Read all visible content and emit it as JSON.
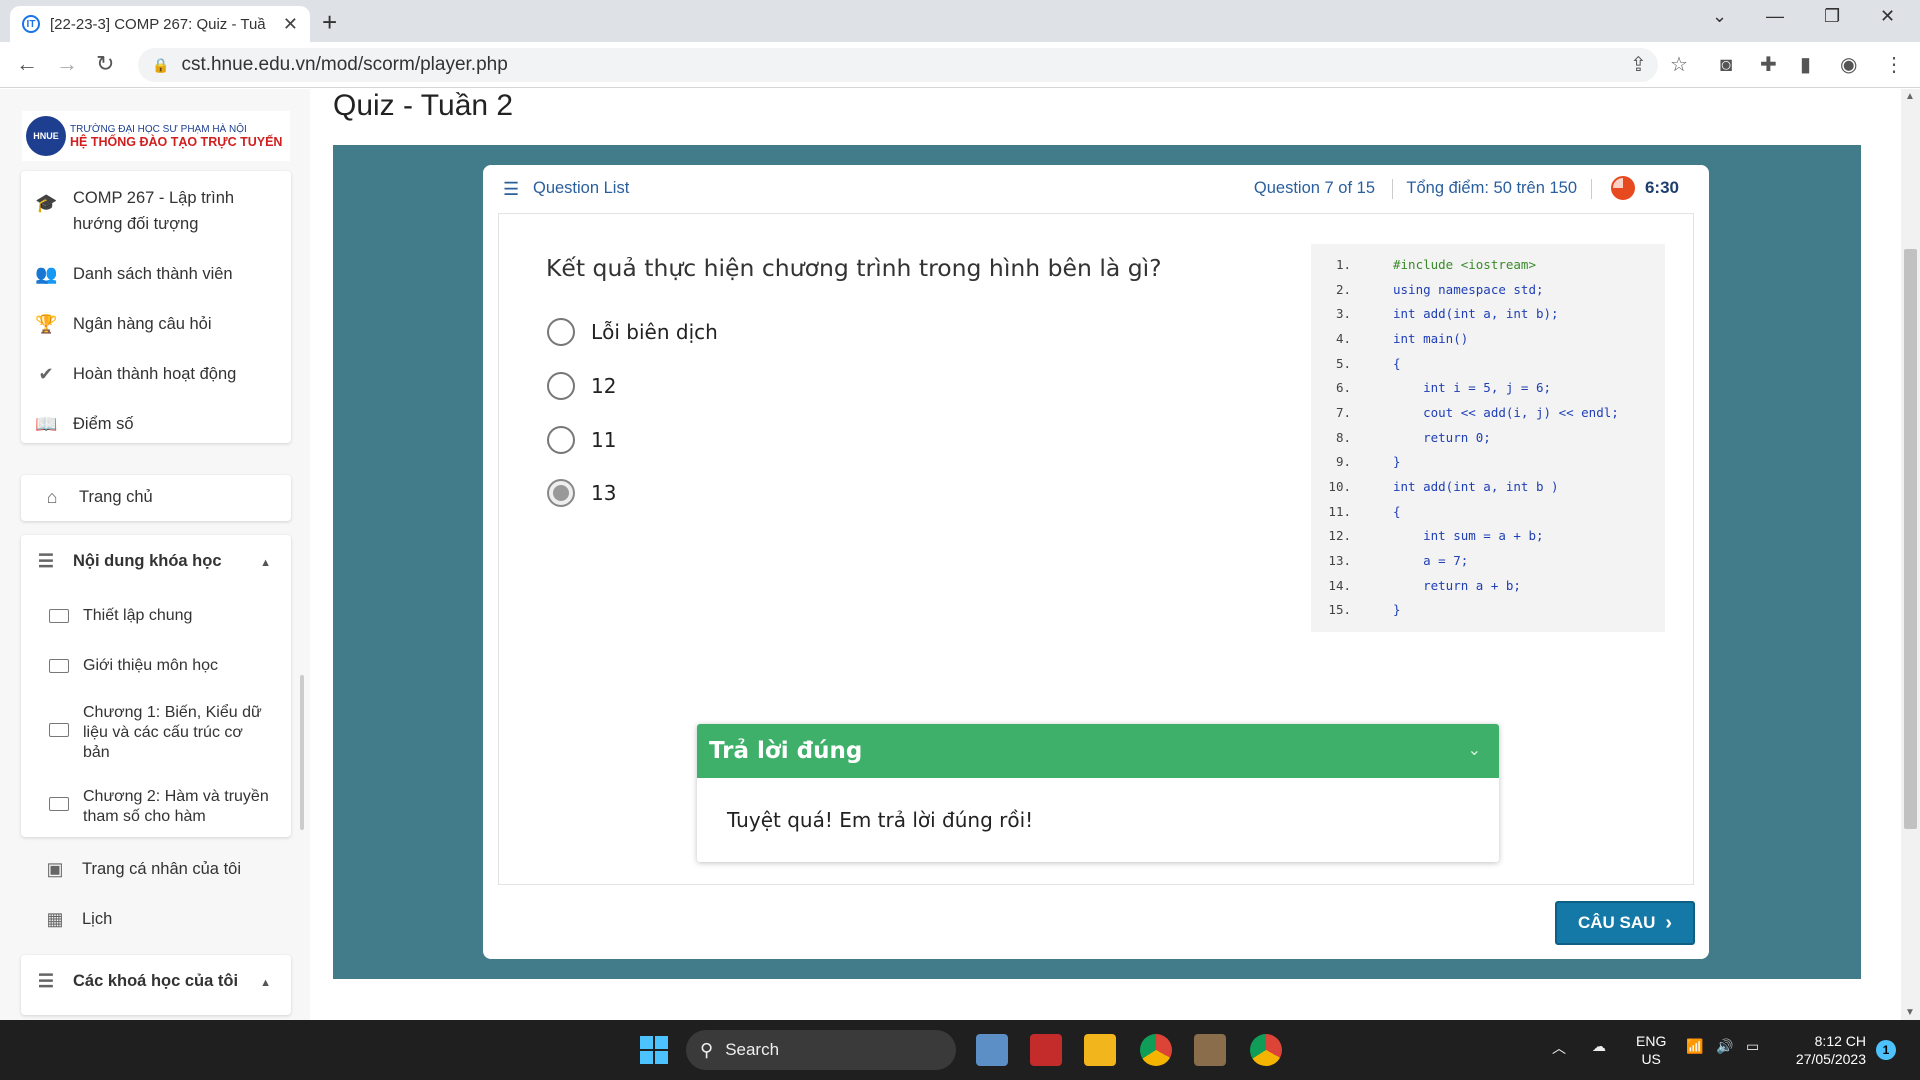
{
  "browser": {
    "tab_title": "[22-23-3] COMP 267: Quiz - Tuầ",
    "url": "cst.hnue.edu.vn/mod/scorm/player.php"
  },
  "sidebar": {
    "logo_line1": "TRƯỜNG ĐẠI HỌC SƯ PHẠM HÀ NỘI",
    "logo_line2": "HỆ THỐNG ĐÀO TẠO TRỰC TUYẾN",
    "course_menu": [
      {
        "label": "COMP 267 - Lập trình hướng đối tượng",
        "icon": "graduation-cap-icon"
      },
      {
        "label": "Danh sách thành viên",
        "icon": "users-icon"
      },
      {
        "label": "Ngân hàng câu hỏi",
        "icon": "trophy-icon"
      },
      {
        "label": "Hoàn thành hoạt động",
        "icon": "check-icon"
      },
      {
        "label": "Điểm số",
        "icon": "book-icon"
      }
    ],
    "home": "Trang chủ",
    "course_content_title": "Nội dung khóa học",
    "course_sections": [
      "Thiết lập chung",
      "Giới thiệu môn học",
      "Chương 1: Biến, Kiểu dữ liệu và các cấu trúc cơ bản",
      "Chương 2: Hàm và truyền tham số cho hàm"
    ],
    "profile": "Trang cá nhân của tôi",
    "calendar": "Lịch",
    "my_courses": "Các khoá học của tôi"
  },
  "page_title": "Quiz - Tuần 2",
  "quiz": {
    "question_list_label": "Question List",
    "progress": "Question 7 of 15",
    "score": "Tổng điểm: 50 trên 150",
    "timer": "6:30",
    "question": "Kết quả thực hiện chương trình trong hình bên là gì?",
    "options": [
      "Lỗi biên dịch",
      "12",
      "11",
      "13"
    ],
    "selected_option": "13",
    "code_lines": [
      {
        "n": "1.",
        "text": "#include <iostream>"
      },
      {
        "n": "2.",
        "text": "using namespace std;"
      },
      {
        "n": "3.",
        "text": "int add(int a, int b);"
      },
      {
        "n": "4.",
        "text": "int main()"
      },
      {
        "n": "5.",
        "text": "{"
      },
      {
        "n": "6.",
        "text": "    int i = 5, j = 6;"
      },
      {
        "n": "7.",
        "text": "    cout << add(i, j) << endl;"
      },
      {
        "n": "8.",
        "text": "    return 0;"
      },
      {
        "n": "9.",
        "text": "}"
      },
      {
        "n": "10.",
        "text": "int add(int a, int b )"
      },
      {
        "n": "11.",
        "text": "{"
      },
      {
        "n": "12.",
        "text": "    int sum = a + b;"
      },
      {
        "n": "13.",
        "text": "    a = 7;"
      },
      {
        "n": "14.",
        "text": "    return a + b;"
      },
      {
        "n": "15.",
        "text": "}"
      }
    ],
    "feedback_title": "Trả lời đúng",
    "feedback_body": "Tuyệt quá! Em trả lời đúng rồi!",
    "next_label": "CÂU SAU"
  },
  "taskbar": {
    "search_label": "Search",
    "lang_line1": "ENG",
    "lang_line2": "US",
    "time": "8:12 CH",
    "date": "27/05/2023",
    "notification_count": "1"
  },
  "colors": {
    "stage": "#427c8a",
    "feedback_header": "#3eb06a",
    "next_button": "#1479a6",
    "link_blue": "#2a5f9e"
  }
}
